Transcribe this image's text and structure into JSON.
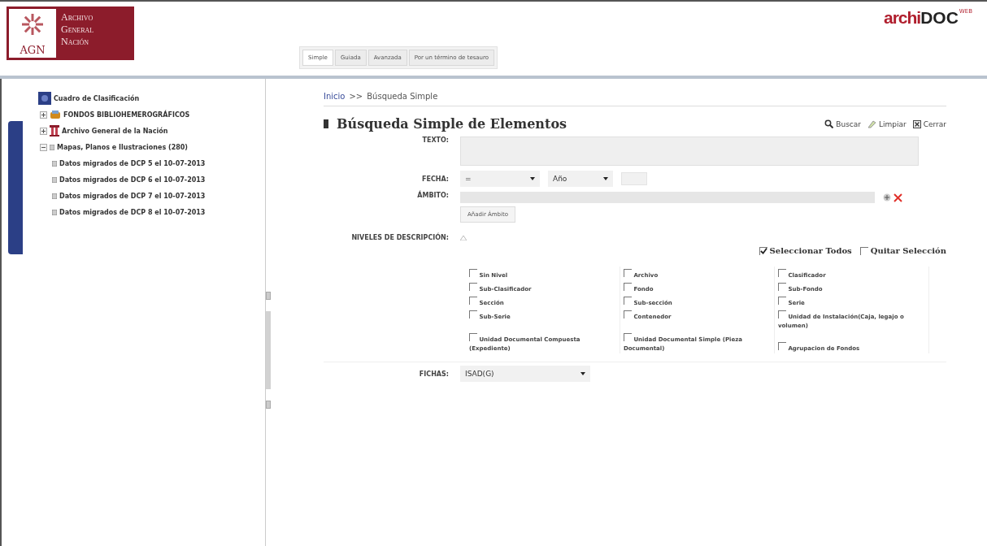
{
  "header": {
    "logo": {
      "lines": [
        "Archivo",
        "General",
        "Nación"
      ],
      "initials": "AGN"
    },
    "brand": {
      "name_start": "archi",
      "name_end": "DOC",
      "superscript": "WEB"
    },
    "tabs": [
      {
        "label": "Simple",
        "selected": true
      },
      {
        "label": "Guiada",
        "selected": false
      },
      {
        "label": "Avanzada",
        "selected": false
      },
      {
        "label": "Por un término de tesauro",
        "selected": false
      }
    ]
  },
  "tree": {
    "root": "Cuadro de Clasificación",
    "children": [
      {
        "label": "FONDOS BIBLIOHEMEROGRÁFICOS",
        "kind": "books",
        "expanded": false
      },
      {
        "label": "Archivo General de la Nación",
        "kind": "building",
        "expanded": false
      },
      {
        "label": "Mapas, Planos e Ilustraciones (280)",
        "kind": "series",
        "expanded": true
      },
      {
        "label": "Datos migrados de DCP 5 el 10-07-2013",
        "kind": "series"
      },
      {
        "label": "Datos migrados de DCP 6 el 10-07-2013",
        "kind": "series"
      },
      {
        "label": "Datos migrados de DCP 7 el 10-07-2013",
        "kind": "series"
      },
      {
        "label": "Datos migrados de DCP 8 el 10-07-2013",
        "kind": "series"
      }
    ]
  },
  "breadcrumb": {
    "home": "Inicio",
    "separator": ">>",
    "current": "Búsqueda Simple"
  },
  "title": "Búsqueda Simple de Elementos",
  "actions": [
    {
      "label": "Buscar",
      "kind": "search"
    },
    {
      "label": "Limpiar",
      "kind": "clear"
    },
    {
      "label": "Cerrar",
      "kind": "close"
    }
  ],
  "form": {
    "texto_label": "TEXTO:",
    "fecha_label": "FECHA:",
    "fecha_operator": "=",
    "fecha_unit": "Año",
    "ambito_label": "ÁMBITO:",
    "ambito_button": "Añadir Ámbito",
    "niveles_label": "NIVELES DE DESCRIPCIÓN:",
    "fichas_label": "FICHAS:",
    "fichas_value": "ISAD(G)"
  },
  "select_all": {
    "label": "Seleccionar Todos",
    "checked": true
  },
  "clear_selection": {
    "label": "Quitar Selección",
    "checked": false
  },
  "levels": [
    [
      {
        "label": "Sin Nivel",
        "checked": false
      },
      {
        "label": "Sub-Clasificador",
        "checked": false
      },
      {
        "label": "Sección",
        "checked": false
      },
      {
        "label": "Sub-Serie",
        "checked": false
      },
      {
        "label": "Unidad Documental Compuesta (Expediente)",
        "checked": false
      }
    ],
    [
      {
        "label": "Archivo",
        "checked": false
      },
      {
        "label": "Fondo",
        "checked": false
      },
      {
        "label": "Sub-sección",
        "checked": false
      },
      {
        "label": "Contenedor",
        "checked": false
      },
      {
        "label": "Unidad Documental Simple (Pieza Documental)",
        "checked": false
      }
    ],
    [
      {
        "label": "Clasificador",
        "checked": false
      },
      {
        "label": "Sub-Fondo",
        "checked": false
      },
      {
        "label": "Serie",
        "checked": false
      },
      {
        "label": "Unidad de Instalación(Caja, legajo o volumen)",
        "checked": false
      },
      {
        "label": "Agrupacion de Fondos",
        "checked": false
      }
    ]
  ]
}
